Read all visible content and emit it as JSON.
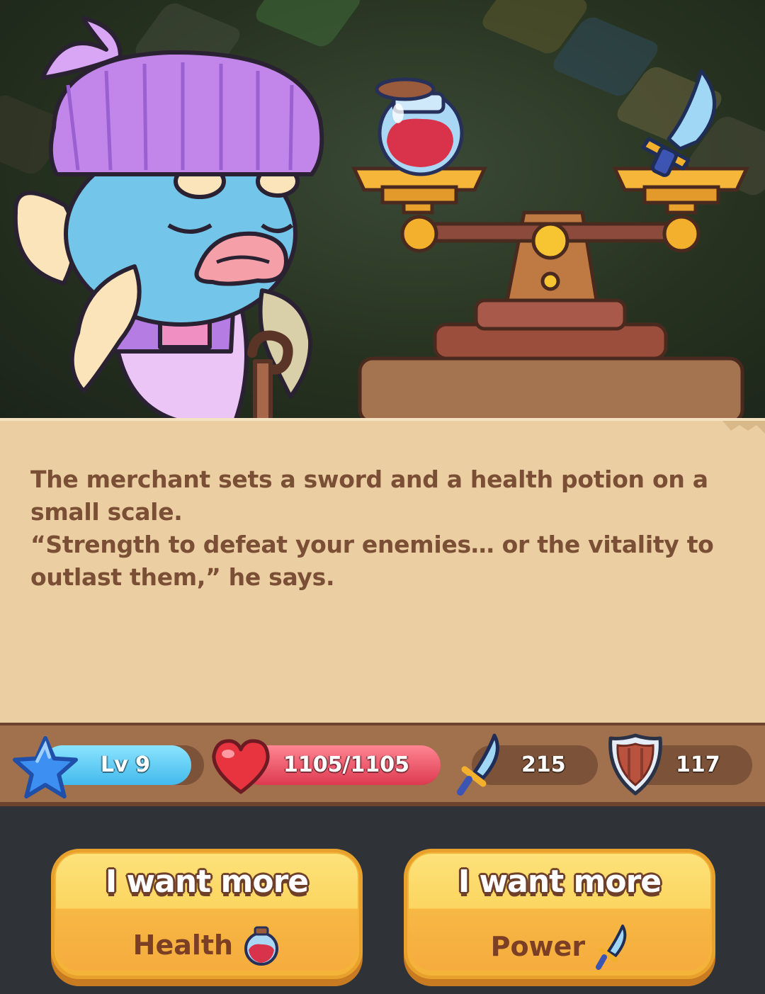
{
  "story": {
    "line1": "The merchant sets a sword and a health potion on a small scale.",
    "line2": "“Strength to defeat your enemies… or the vitality to outlast them,” he says."
  },
  "stats": {
    "level": "Lv 9",
    "health": "1105/1105",
    "health_fraction": 1.0,
    "attack": "215",
    "defense": "117"
  },
  "choices": [
    {
      "line1": "I want more",
      "line2": "Health",
      "icon": "potion-icon"
    },
    {
      "line1": "I want more",
      "line2": "Power",
      "icon": "sword-icon"
    }
  ],
  "colors": {
    "panel": "#ebcfa2",
    "text": "#7a4f35",
    "level_bar": "#4fc7f3",
    "health_bar": "#e0465a",
    "button": "#f6ac3e"
  }
}
